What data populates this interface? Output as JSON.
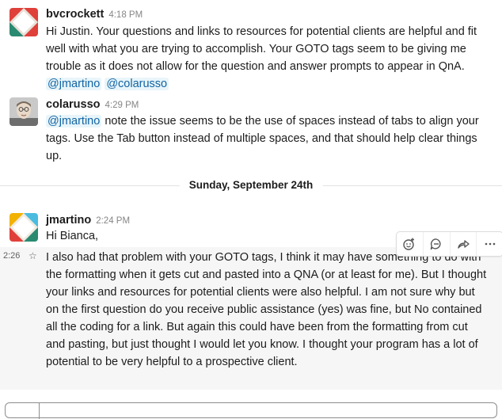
{
  "messages": [
    {
      "author": "bvcrockett",
      "time": "4:18 PM",
      "text": "Hi Justin. Your questions and links to resources for potential clients are helpful and fit well with what you are trying to accomplish. Your GOTO tags seem to be giving me trouble as it does not allow for the question and answer prompts to appear in QnA.",
      "mentions": [
        "@jmartino",
        "@colarusso"
      ]
    },
    {
      "author": "colarusso",
      "time": "4:29 PM",
      "mention": "@jmartino",
      "text": "note the issue seems to be the use of spaces instead of tabs to align your tags. Use the Tab button instead of multiple spaces, and that should help clear things up."
    },
    {
      "author": "jmartino",
      "time": "2:24 PM",
      "text": "Hi Bianca,"
    },
    {
      "gutter_time": "2:26",
      "text": "I also had that problem with your GOTO tags, I think it may have something to do with the formatting when it gets cut and pasted into a QNA (or at least for me). But I thought your links and resources for potential clients were also helpful. I am not sure why but on the first question do you receive public assistance (yes) was fine, but No contained all the coding for a link. But again this could have been from the formatting from cut and pasting, but just thought I would let you know. I thought your program has a lot of potential to be very helpful to a prospective client."
    }
  ],
  "day_divider": "Sunday, September 24th",
  "message_actions": [
    {
      "icon": "add-reaction-icon"
    },
    {
      "icon": "reply-thread-icon"
    },
    {
      "icon": "share-icon"
    },
    {
      "icon": "more-actions-icon"
    }
  ],
  "colors": {
    "mention_text": "#1264a3",
    "mention_bg": "#e8f5fa",
    "hover_bg": "#f6f6f6"
  }
}
